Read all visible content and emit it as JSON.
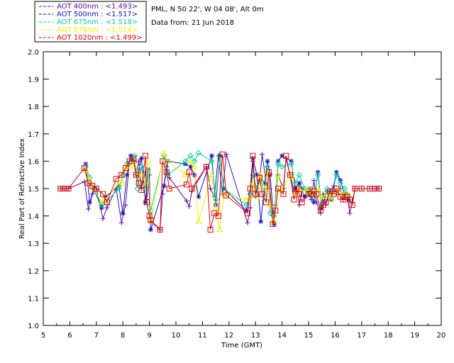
{
  "header": {
    "site": "PML, N 50 22', W 04 08', Alt 0m",
    "date": "Data from: 21 Jun 2018"
  },
  "chart_data": {
    "type": "scatter",
    "xlabel": "Time (GMT)",
    "ylabel": "Real Part of Refractive Index",
    "xlim": [
      5,
      20
    ],
    "ylim": [
      1.0,
      2.0
    ],
    "x_ticks": [
      "5",
      "6",
      "7",
      "8",
      "9",
      "10",
      "11",
      "12",
      "13",
      "14",
      "15",
      "16",
      "17",
      "18",
      "19",
      "20"
    ],
    "y_ticks": [
      "1.0",
      "1.1",
      "1.2",
      "1.3",
      "1.4",
      "1.5",
      "1.6",
      "1.7",
      "1.8",
      "1.9",
      "2.0"
    ],
    "legend_placement": "top-left",
    "series": [
      {
        "name": "AOT  400nm : <1.493>",
        "color": "#5a0aa0",
        "marker": "plus",
        "x": [
          5.65,
          5.8,
          5.95,
          6.55,
          6.7,
          6.85,
          7.0,
          7.25,
          7.4,
          7.75,
          7.95,
          8.1,
          8.25,
          8.4,
          8.5,
          8.6,
          8.7,
          8.85,
          8.9,
          9.0,
          9.05,
          9.4,
          9.5,
          9.65,
          9.75,
          10.4,
          10.5,
          10.6,
          11.15,
          11.3,
          11.45,
          11.6,
          11.75,
          11.9,
          12.7,
          12.8,
          12.9,
          13.0,
          13.15,
          13.25,
          13.4,
          13.5,
          13.65,
          13.75,
          13.85,
          14.05,
          14.15,
          14.3,
          14.45,
          14.55,
          14.65,
          14.75,
          15.0,
          15.1,
          15.2,
          15.3,
          15.45,
          15.55,
          15.65,
          15.8,
          15.95,
          16.05,
          16.2,
          16.3,
          16.45,
          16.55,
          16.65,
          16.75,
          17.0,
          17.3,
          17.5,
          17.65
        ],
        "y": [
          1.5,
          1.5,
          1.5,
          1.525,
          1.425,
          1.48,
          1.5,
          1.39,
          1.43,
          1.5,
          1.375,
          1.44,
          1.6,
          1.6,
          1.55,
          1.6,
          1.5,
          1.56,
          1.46,
          1.55,
          1.38,
          1.35,
          1.48,
          1.58,
          1.54,
          1.455,
          1.435,
          1.49,
          1.58,
          1.5,
          1.47,
          1.62,
          1.48,
          1.625,
          1.375,
          1.43,
          1.6,
          1.47,
          1.53,
          1.625,
          1.52,
          1.5,
          1.4,
          1.44,
          1.55,
          1.5,
          1.61,
          1.55,
          1.49,
          1.5,
          1.44,
          1.5,
          1.49,
          1.46,
          1.53,
          1.45,
          1.41,
          1.48,
          1.44,
          1.49,
          1.51,
          1.48,
          1.5,
          1.46,
          1.48,
          1.41,
          1.45,
          1.5,
          1.5,
          1.5,
          1.5,
          1.5
        ]
      },
      {
        "name": "AOT  500nm : <1.517>",
        "color": "#1010c0",
        "marker": "star",
        "x": [
          6.6,
          6.75,
          6.9,
          7.2,
          7.35,
          7.85,
          8.0,
          8.15,
          8.3,
          8.45,
          8.55,
          8.7,
          8.85,
          8.95,
          9.05,
          9.55,
          9.7,
          10.35,
          10.55,
          10.7,
          10.85,
          11.35,
          11.5,
          11.65,
          11.8,
          12.65,
          12.8,
          12.9,
          13.05,
          13.2,
          13.35,
          13.45,
          13.55,
          13.7,
          13.85,
          14.0,
          14.35,
          14.5,
          14.65,
          14.85,
          15.05,
          15.2,
          15.35,
          15.5,
          15.7,
          15.85,
          16.05,
          16.2,
          16.35,
          16.5
        ],
        "y": [
          1.59,
          1.45,
          1.5,
          1.43,
          1.47,
          1.51,
          1.41,
          1.55,
          1.62,
          1.6,
          1.55,
          1.61,
          1.45,
          1.57,
          1.35,
          1.51,
          1.6,
          1.59,
          1.58,
          1.55,
          1.47,
          1.62,
          1.44,
          1.62,
          1.5,
          1.42,
          1.48,
          1.61,
          1.55,
          1.38,
          1.52,
          1.6,
          1.55,
          1.37,
          1.6,
          1.62,
          1.6,
          1.5,
          1.52,
          1.47,
          1.5,
          1.45,
          1.56,
          1.43,
          1.49,
          1.46,
          1.56,
          1.53,
          1.48,
          1.46
        ]
      },
      {
        "name": "AOT  675nm : <1.518>",
        "color": "#00d0a0",
        "marker": "diamond",
        "x": [
          6.6,
          6.75,
          6.9,
          7.2,
          7.35,
          7.85,
          8.0,
          8.15,
          8.3,
          8.45,
          8.55,
          8.7,
          8.85,
          8.95,
          9.05,
          9.55,
          9.7,
          10.35,
          10.55,
          10.7,
          10.85,
          11.35,
          11.5,
          11.65,
          11.8,
          12.65,
          12.8,
          12.9,
          13.05,
          13.2,
          13.35,
          13.45,
          13.55,
          13.7,
          13.85,
          14.0,
          14.35,
          14.5,
          14.65,
          14.85,
          15.05,
          15.2,
          15.35,
          15.5,
          15.7,
          15.85,
          16.05,
          16.2,
          16.35,
          16.5
        ],
        "y": [
          1.58,
          1.54,
          1.5,
          1.44,
          1.45,
          1.5,
          1.55,
          1.59,
          1.6,
          1.62,
          1.5,
          1.58,
          1.5,
          1.56,
          1.42,
          1.62,
          1.55,
          1.6,
          1.62,
          1.6,
          1.63,
          1.6,
          1.46,
          1.62,
          1.5,
          1.44,
          1.48,
          1.55,
          1.5,
          1.53,
          1.47,
          1.58,
          1.41,
          1.4,
          1.59,
          1.58,
          1.59,
          1.52,
          1.55,
          1.5,
          1.48,
          1.47,
          1.55,
          1.44,
          1.5,
          1.46,
          1.55,
          1.52,
          1.5,
          1.47
        ]
      },
      {
        "name": "AOT  870nm : <1.514>",
        "color": "#f0f000",
        "marker": "triangle",
        "x": [
          6.6,
          6.75,
          6.9,
          7.2,
          7.35,
          7.85,
          8.0,
          8.15,
          8.3,
          8.45,
          8.55,
          8.7,
          8.85,
          8.95,
          9.05,
          9.55,
          9.7,
          10.35,
          10.55,
          10.7,
          10.85,
          11.35,
          11.5,
          11.65,
          11.8,
          12.65,
          12.8,
          12.9,
          13.05,
          13.2,
          13.35,
          13.45,
          13.55,
          13.7,
          13.85,
          14.0,
          14.35,
          14.5,
          14.65,
          14.85,
          15.05,
          15.2,
          15.35,
          15.5,
          15.7,
          15.85,
          16.05,
          16.2,
          16.35,
          16.5
        ],
        "y": [
          1.57,
          1.53,
          1.5,
          1.45,
          1.46,
          1.52,
          1.52,
          1.58,
          1.58,
          1.6,
          1.55,
          1.55,
          1.52,
          1.6,
          1.38,
          1.63,
          1.6,
          1.55,
          1.6,
          1.58,
          1.38,
          1.55,
          1.43,
          1.35,
          1.48,
          1.46,
          1.47,
          1.52,
          1.47,
          1.55,
          1.5,
          1.56,
          1.44,
          1.38,
          1.55,
          1.5,
          1.55,
          1.48,
          1.5,
          1.49,
          1.5,
          1.48,
          1.5,
          1.47,
          1.48,
          1.46,
          1.49,
          1.49,
          1.48,
          1.48
        ]
      },
      {
        "name": "AOT 1020nm : <1.499>",
        "color": "#e00000",
        "marker": "square",
        "x": [
          5.65,
          5.8,
          5.95,
          6.55,
          6.7,
          6.85,
          7.0,
          7.25,
          7.4,
          7.75,
          7.95,
          8.1,
          8.25,
          8.4,
          8.5,
          8.6,
          8.7,
          8.85,
          8.9,
          9.0,
          9.05,
          9.4,
          9.5,
          9.65,
          9.75,
          10.4,
          10.5,
          10.6,
          11.15,
          11.3,
          11.45,
          11.6,
          11.75,
          11.9,
          12.7,
          12.8,
          12.9,
          13.0,
          13.15,
          13.25,
          13.4,
          13.5,
          13.65,
          13.75,
          13.85,
          14.05,
          14.15,
          14.3,
          14.45,
          14.55,
          14.65,
          14.75,
          15.0,
          15.1,
          15.2,
          15.3,
          15.45,
          15.55,
          15.65,
          15.8,
          15.95,
          16.05,
          16.2,
          16.3,
          16.45,
          16.55,
          16.65,
          16.75,
          17.0,
          17.3,
          17.5,
          17.65
        ],
        "y": [
          1.5,
          1.5,
          1.5,
          1.575,
          1.52,
          1.51,
          1.5,
          1.48,
          1.45,
          1.535,
          1.55,
          1.575,
          1.6,
          1.61,
          1.55,
          1.52,
          1.495,
          1.62,
          1.45,
          1.4,
          1.385,
          1.35,
          1.6,
          1.56,
          1.5,
          1.515,
          1.56,
          1.5,
          1.58,
          1.35,
          1.41,
          1.4,
          1.625,
          1.475,
          1.41,
          1.5,
          1.62,
          1.48,
          1.54,
          1.48,
          1.45,
          1.56,
          1.37,
          1.42,
          1.5,
          1.48,
          1.62,
          1.55,
          1.46,
          1.5,
          1.48,
          1.45,
          1.48,
          1.48,
          1.49,
          1.48,
          1.42,
          1.44,
          1.45,
          1.49,
          1.48,
          1.5,
          1.47,
          1.46,
          1.47,
          1.46,
          1.44,
          1.5,
          1.5,
          1.5,
          1.5,
          1.5
        ]
      }
    ]
  }
}
